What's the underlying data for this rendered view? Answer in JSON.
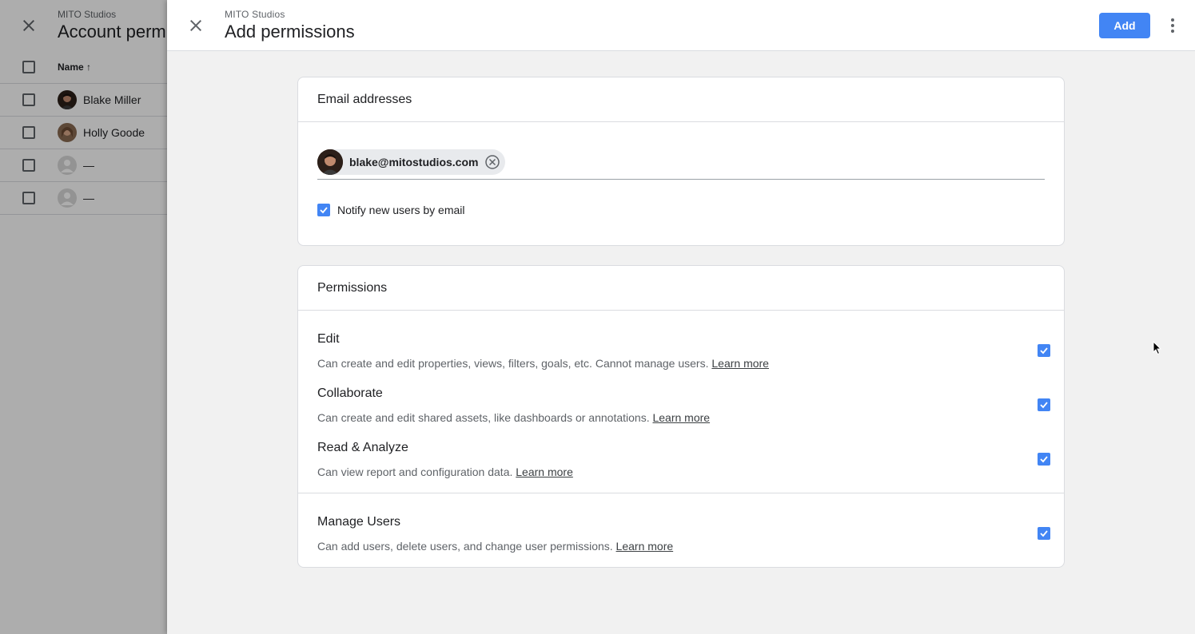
{
  "background_panel": {
    "org": "MITO Studios",
    "title": "Account perm",
    "table_header": "Name",
    "rows": [
      {
        "name": "Blake Miller",
        "has_photo": true
      },
      {
        "name": "Holly Goode",
        "has_photo": true
      },
      {
        "name": "—",
        "has_photo": false
      },
      {
        "name": "—",
        "has_photo": false
      }
    ]
  },
  "header": {
    "org": "MITO Studios",
    "title": "Add permissions",
    "add_label": "Add",
    "close_icon": "close-icon",
    "more_icon": "more-vert-icon"
  },
  "email_card": {
    "title": "Email addresses",
    "chip_email": "blake@mitostudios.com",
    "notify_label": "Notify new users by email",
    "notify_checked": true
  },
  "permissions_card": {
    "title": "Permissions",
    "items": [
      {
        "name": "Edit",
        "desc": "Can create and edit properties, views, filters, goals, etc. Cannot manage users.",
        "link": "Learn more",
        "checked": true
      },
      {
        "name": "Collaborate",
        "desc": "Can create and edit shared assets, like dashboards or annotations.",
        "link": "Learn more",
        "checked": true
      },
      {
        "name": "Read & Analyze",
        "desc": "Can view report and configuration data.",
        "link": "Learn more",
        "checked": true
      },
      {
        "name": "Manage Users",
        "desc": "Can add users, delete users, and change user permissions.",
        "link": "Learn more",
        "checked": true
      }
    ]
  },
  "colors": {
    "accent": "#4285f4",
    "background": "#f1f1f1",
    "border": "#dadce0"
  }
}
